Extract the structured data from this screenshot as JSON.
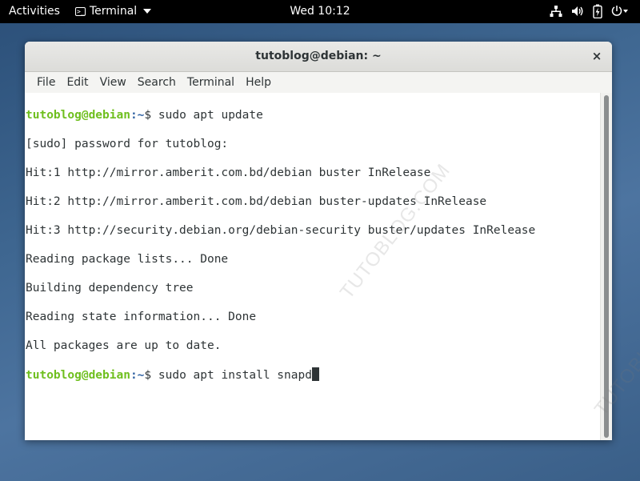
{
  "topbar": {
    "activities": "Activities",
    "app_menu": "Terminal",
    "clock": "Wed 10:12",
    "tray_icons": [
      "network-icon",
      "volume-icon",
      "battery-icon",
      "power-menu-icon"
    ]
  },
  "window": {
    "title": "tutoblog@debian: ~",
    "close_label": "×",
    "menu": [
      "File",
      "Edit",
      "View",
      "Search",
      "Terminal",
      "Help"
    ]
  },
  "terminal": {
    "prompt_user": "tutoblog@debian",
    "prompt_path": ":~",
    "prompt_symbol": "$ ",
    "command1": "sudo apt update",
    "output": [
      "[sudo] password for tutoblog:",
      "Hit:1 http://mirror.amberit.com.bd/debian buster InRelease",
      "Hit:2 http://mirror.amberit.com.bd/debian buster-updates InRelease",
      "Hit:3 http://security.debian.org/debian-security buster/updates InRelease",
      "Reading package lists... Done",
      "Building dependency tree",
      "Reading state information... Done",
      "All packages are up to date."
    ],
    "command2": "sudo apt install snapd"
  },
  "watermarks": [
    "TUTOBLOG.COM",
    "TUTOBLOG"
  ]
}
